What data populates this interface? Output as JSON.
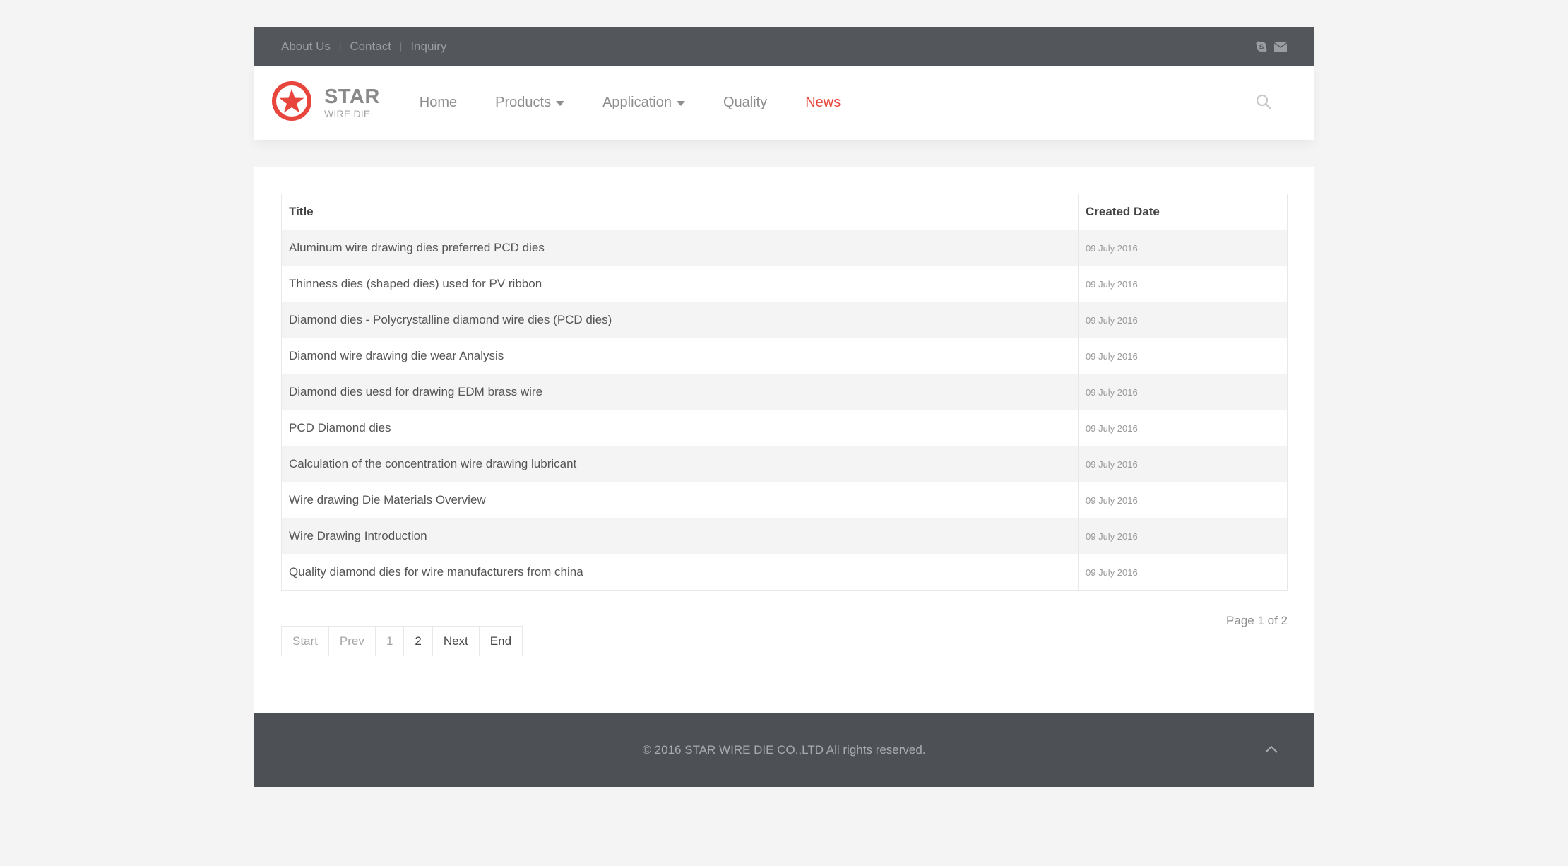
{
  "topbar": {
    "links": [
      "About Us",
      "Contact",
      "Inquiry"
    ],
    "social_icons": [
      "skype-icon",
      "mail-icon"
    ]
  },
  "brand": {
    "name": "STAR",
    "tagline": "WIRE DIE",
    "accent_color": "#e8453c"
  },
  "nav": {
    "items": [
      {
        "label": "Home",
        "dropdown": false,
        "active": false
      },
      {
        "label": "Products",
        "dropdown": true,
        "active": false
      },
      {
        "label": "Application",
        "dropdown": true,
        "active": false
      },
      {
        "label": "Quality",
        "dropdown": false,
        "active": false
      },
      {
        "label": "News",
        "dropdown": false,
        "active": true
      }
    ],
    "search_icon": "search-icon"
  },
  "table": {
    "columns": [
      "Title",
      "Created Date"
    ],
    "rows": [
      {
        "title": "Aluminum wire drawing dies preferred PCD dies",
        "date": "09 July 2016"
      },
      {
        "title": "Thinness dies (shaped dies) used for PV ribbon",
        "date": "09 July 2016"
      },
      {
        "title": "Diamond dies - Polycrystalline diamond wire dies (PCD dies)",
        "date": "09 July 2016"
      },
      {
        "title": "Diamond wire drawing die wear Analysis",
        "date": "09 July 2016"
      },
      {
        "title": "Diamond dies uesd for drawing EDM brass wire",
        "date": "09 July 2016"
      },
      {
        "title": "PCD Diamond dies",
        "date": "09 July 2016"
      },
      {
        "title": "Calculation of the concentration wire drawing lubricant",
        "date": "09 July 2016"
      },
      {
        "title": "Wire drawing Die Materials Overview",
        "date": "09 July 2016"
      },
      {
        "title": "Wire Drawing Introduction",
        "date": "09 July 2016"
      },
      {
        "title": "Quality diamond dies for wire manufacturers from china",
        "date": "09 July 2016"
      }
    ]
  },
  "pagination": {
    "page_info": "Page 1 of 2",
    "buttons": [
      {
        "label": "Start",
        "disabled": true
      },
      {
        "label": "Prev",
        "disabled": true
      },
      {
        "label": "1",
        "disabled": true
      },
      {
        "label": "2",
        "disabled": false
      },
      {
        "label": "Next",
        "disabled": false
      },
      {
        "label": "End",
        "disabled": false
      }
    ]
  },
  "footer": {
    "copyright": "© 2016 STAR WIRE DIE CO.,LTD All rights reserved.",
    "back_to_top_icon": "chevron-up-icon"
  }
}
